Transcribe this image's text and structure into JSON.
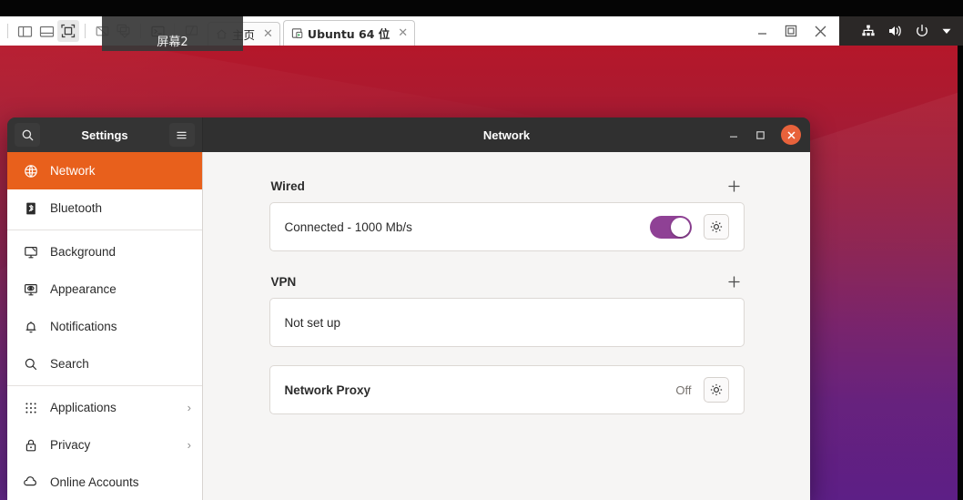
{
  "vmware": {
    "toolbar_buttons": [
      {
        "name": "sidebar-toggle-icon",
        "glyph": "panel-left"
      },
      {
        "name": "thumbnail-bar-icon",
        "glyph": "panel-bottom"
      },
      {
        "name": "fullscreen-icon",
        "glyph": "fullscreen"
      },
      {
        "name": "screen-disabled-icon",
        "glyph": "screen-off"
      },
      {
        "name": "multiple-screens-icon",
        "glyph": "screens"
      },
      {
        "name": "console-icon",
        "glyph": "terminal"
      },
      {
        "name": "unity-mode-icon",
        "glyph": "unity"
      }
    ],
    "tooltip": "屏幕2",
    "tabs": [
      {
        "label": "主页",
        "icon": "home-icon",
        "selected": false,
        "close": "✕"
      },
      {
        "label": "Ubuntu 64 位",
        "icon": "vm-play-icon",
        "selected": true,
        "close": "✕"
      }
    ],
    "window_controls": {
      "minimize": "minimize-icon",
      "restore": "restore-icon",
      "close": "close-icon"
    }
  },
  "ubuntu_topbar": {
    "indicators": [
      "network-icon",
      "volume-icon",
      "power-icon",
      "chevron-down-icon"
    ]
  },
  "settings_window": {
    "sidebar_title": "Settings",
    "search_icon": "search-icon",
    "menu_icon": "hamburger-menu-icon",
    "main_title": "Network",
    "controls": {
      "minimize": "−",
      "maximize": "□",
      "close": "✕"
    },
    "sidebar": {
      "items": [
        {
          "label": "Network",
          "icon": "globe-icon",
          "selected": true,
          "chevron": ""
        },
        {
          "label": "Bluetooth",
          "icon": "bluetooth-icon",
          "selected": false,
          "chevron": ""
        },
        {
          "label": "Background",
          "icon": "monitor-icon",
          "selected": false,
          "chevron": ""
        },
        {
          "label": "Appearance",
          "icon": "appearance-icon",
          "selected": false,
          "chevron": ""
        },
        {
          "label": "Notifications",
          "icon": "bell-icon",
          "selected": false,
          "chevron": ""
        },
        {
          "label": "Search",
          "icon": "search-icon",
          "selected": false,
          "chevron": ""
        },
        {
          "label": "Applications",
          "icon": "grid-apps-icon",
          "selected": false,
          "chevron": "›"
        },
        {
          "label": "Privacy",
          "icon": "lock-icon",
          "selected": false,
          "chevron": "›"
        },
        {
          "label": "Online Accounts",
          "icon": "cloud-icon",
          "selected": false,
          "chevron": ""
        }
      ],
      "separator_after": [
        1,
        5
      ]
    },
    "content": {
      "wired": {
        "title": "Wired",
        "add_label": "+",
        "status": "Connected - 1000 Mb/s",
        "toggle_on": true,
        "settings_icon": "gear-icon"
      },
      "vpn": {
        "title": "VPN",
        "add_label": "+",
        "status": "Not set up"
      },
      "proxy": {
        "title": "Network Proxy",
        "state": "Off",
        "settings_icon": "gear-icon"
      }
    }
  },
  "colors": {
    "accent_orange": "#e8601c",
    "toggle_purple": "#8f4195",
    "close_button": "#e8623b",
    "header_dark": "#303030",
    "content_bg": "#f6f5f4"
  }
}
